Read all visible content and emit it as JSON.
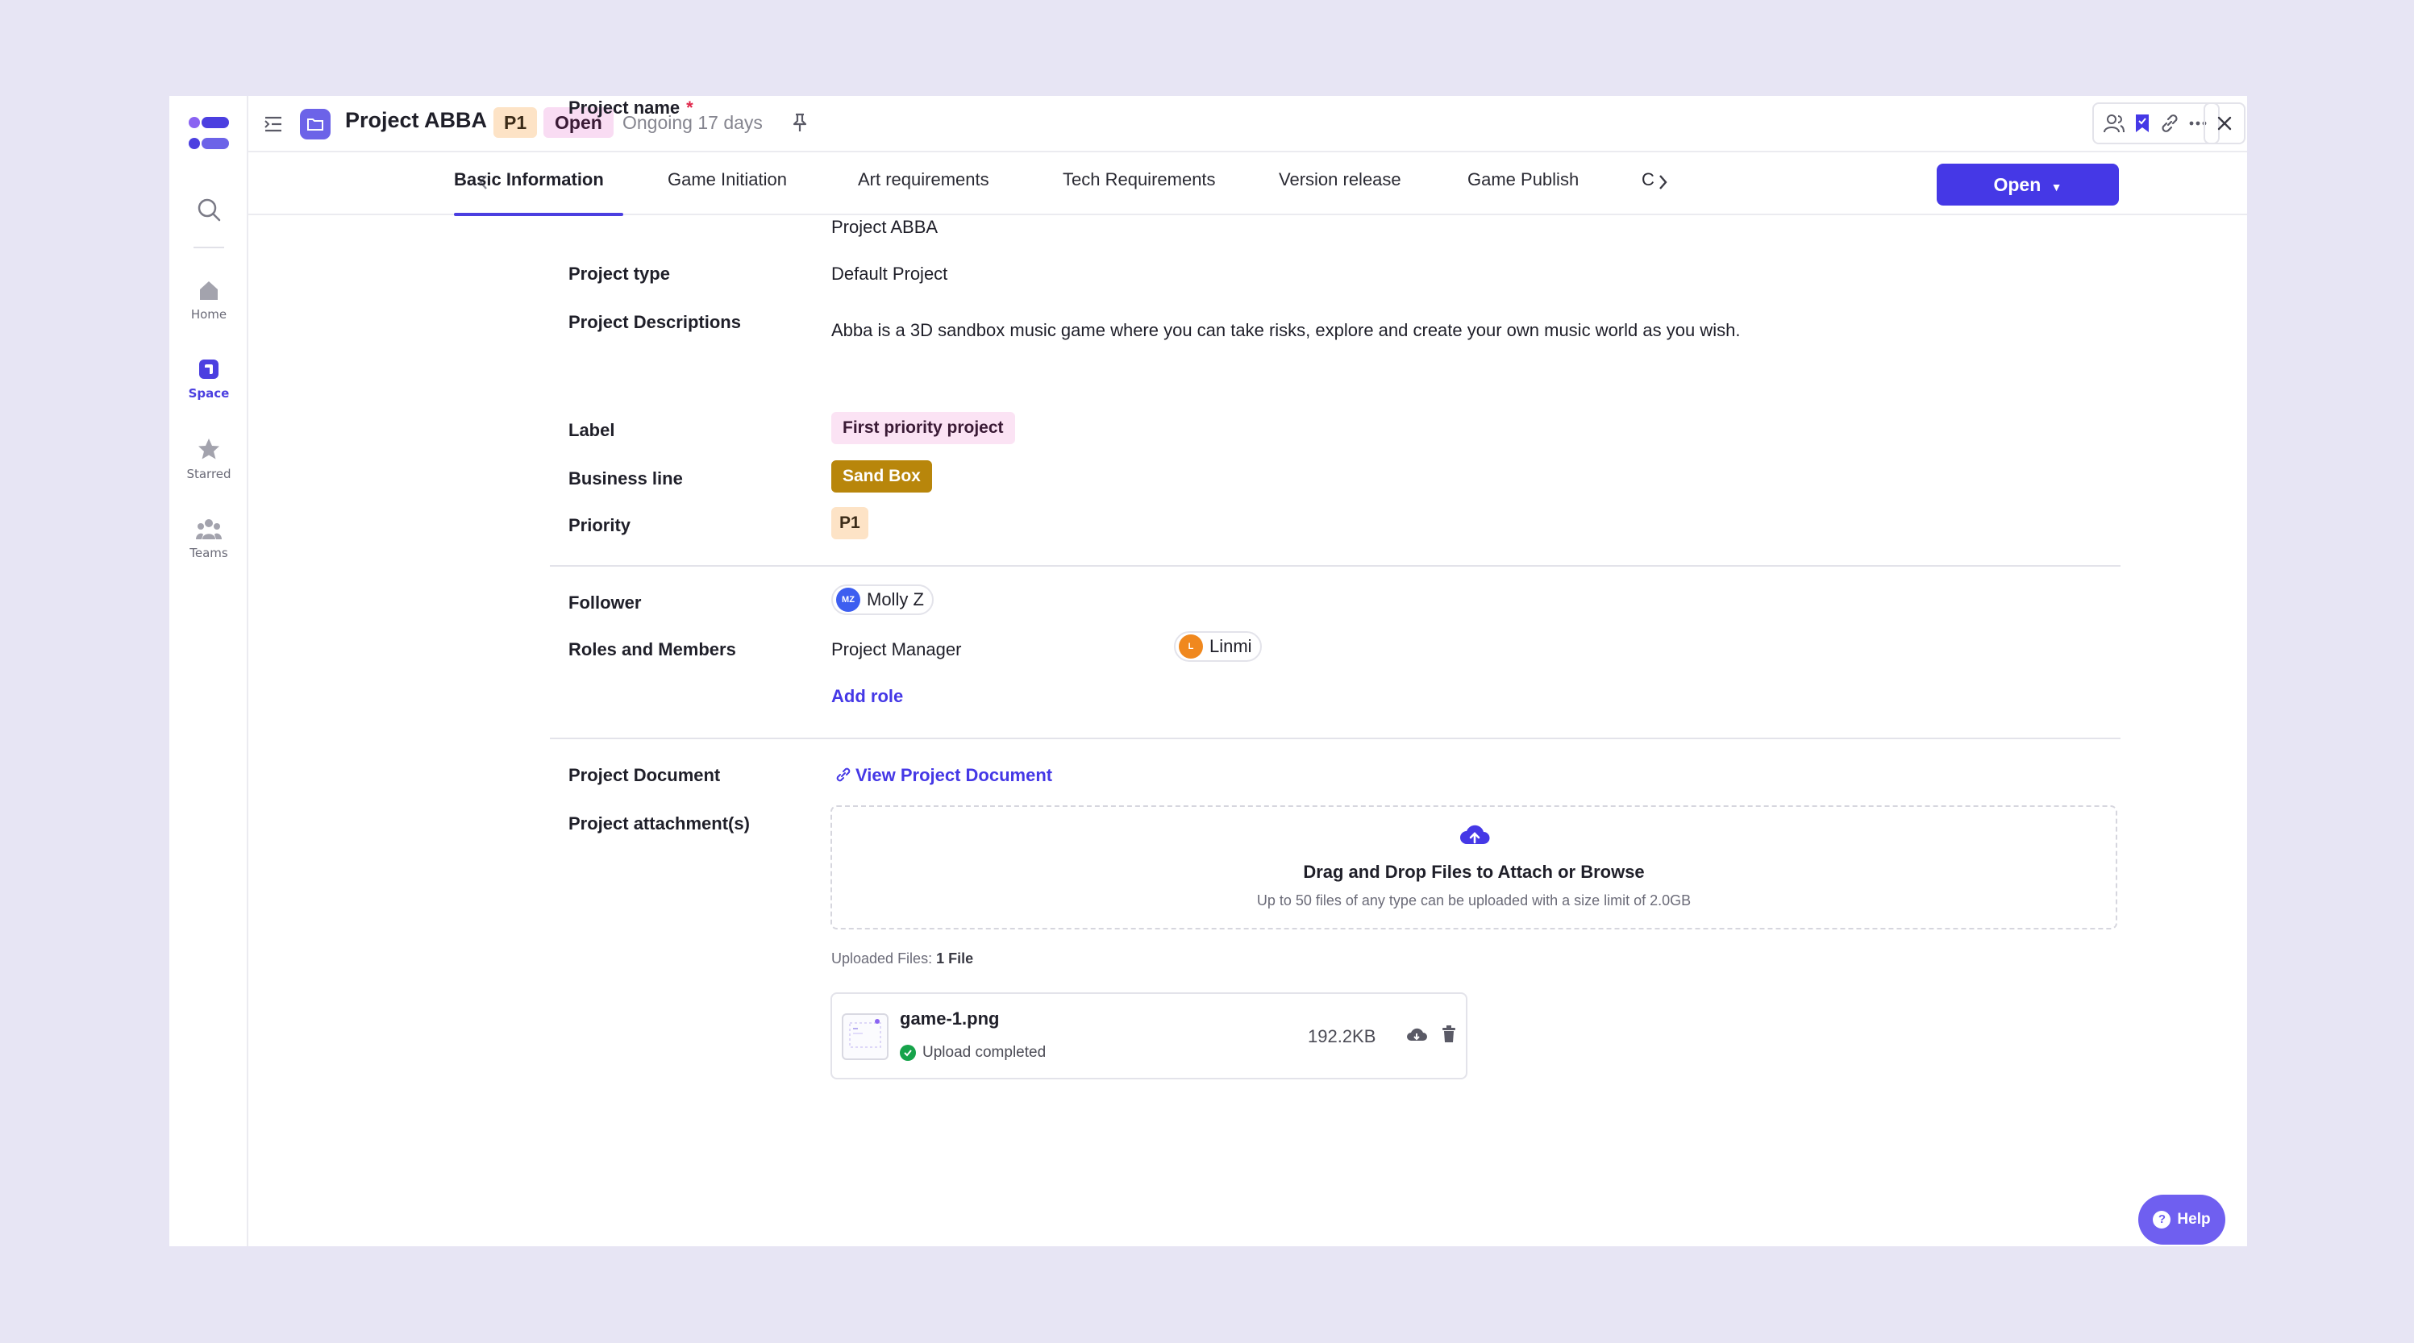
{
  "header": {
    "project_title": "Project ABBA",
    "priority_chip": "P1",
    "status_chip": "Open",
    "ongoing_text": "Ongoing 17 days"
  },
  "sidebar": {
    "items": [
      {
        "label": "Home",
        "icon": "home-icon"
      },
      {
        "label": "Space",
        "icon": "space-icon",
        "active": true
      },
      {
        "label": "Starred",
        "icon": "star-icon"
      },
      {
        "label": "Teams",
        "icon": "teams-icon"
      }
    ]
  },
  "tabs": {
    "items": [
      "Basic Information",
      "Game Initiation",
      "Art requirements",
      "Tech Requirements",
      "Version release",
      "Game Publish",
      "C"
    ],
    "active": "Basic Information",
    "status_button": "Open"
  },
  "fields": {
    "project_name_label": "Project name",
    "project_name_required": "*",
    "project_name_value": "Project ABBA",
    "project_type_label": "Project type",
    "project_type_value": "Default Project",
    "descriptions_label": "Project Descriptions",
    "descriptions_value": "Abba is a 3D sandbox music game where you can take risks, explore and create your own music world as you wish.",
    "label_label": "Label",
    "label_value": "First priority project",
    "business_line_label": "Business line",
    "business_line_value": "Sand Box",
    "priority_label": "Priority",
    "priority_value": "P1",
    "follower_label": "Follower",
    "follower_initials": "MZ",
    "follower_name": "Molly Z",
    "roles_label": "Roles and Members",
    "role_name": "Project Manager",
    "member_initial": "L",
    "member_name": "Linmi",
    "add_role": "Add role",
    "document_label": "Project Document",
    "document_link": "View Project Document",
    "attachments_label": "Project attachment(s)"
  },
  "upload": {
    "title": "Drag and Drop Files to Attach or Browse",
    "subtitle": "Up to 50 files of any type can be uploaded with a size limit of 2.0GB",
    "uploaded_prefix": "Uploaded Files:",
    "uploaded_count": "1 File",
    "file": {
      "name": "game-1.png",
      "status": "Upload completed",
      "size": "192.2KB"
    }
  },
  "help": {
    "label": "Help"
  },
  "colors": {
    "accent": "#4538e6",
    "label_tag_bg": "#fbe3f4",
    "business_tag_bg": "#b8860b",
    "priority_bg": "#fde3c6",
    "success": "#16a34a"
  }
}
